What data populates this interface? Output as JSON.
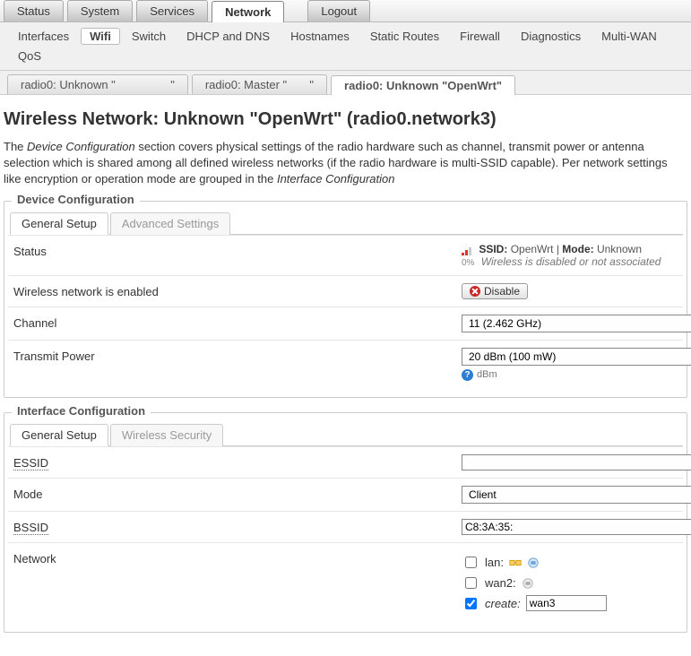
{
  "main_tabs": {
    "status": "Status",
    "system": "System",
    "services": "Services",
    "network": "Network",
    "logout": "Logout"
  },
  "sub_nav": {
    "interfaces": "Interfaces",
    "wifi": "Wifi",
    "switch": "Switch",
    "dhcp_dns": "DHCP and DNS",
    "hostnames": "Hostnames",
    "static_routes": "Static Routes",
    "firewall": "Firewall",
    "diagnostics": "Diagnostics",
    "multi_wan": "Multi-WAN",
    "qos": "QoS"
  },
  "tier3": {
    "t1": "radio0: Unknown \"",
    "t2": "radio0: Master \"",
    "t3": "radio0: Unknown \"OpenWrt\""
  },
  "page": {
    "title": "Wireless Network: Unknown \"OpenWrt\" (radio0.network3)",
    "desc_a": "The ",
    "desc_a_em": "Device Configuration",
    "desc_b": " section covers physical settings of the radio hardware such as channel, transmit power or antenna selection which is shared among all defined wireless networks (if the radio hardware is multi-SSID capable). Per network settings like encryption or operation mode are grouped in the ",
    "desc_b_em": "Interface Configuration"
  },
  "dev": {
    "legend": "Device Configuration",
    "tab_general": "General Setup",
    "tab_adv": "Advanced Settings",
    "status_label": "Status",
    "ssid_lbl": "SSID:",
    "ssid_val": "OpenWrt",
    "mode_lbl": "Mode:",
    "mode_val": "Unknown",
    "pct": "0%",
    "assoc_hint": "Wireless is disabled or not associated",
    "enabled_label": "Wireless network is enabled",
    "disable_btn": "Disable",
    "channel_label": "Channel",
    "channel_val": "11 (2.462 GHz)",
    "tx_label": "Transmit Power",
    "tx_val": "20 dBm (100 mW)",
    "tx_hint": "dBm"
  },
  "iface": {
    "legend": "Interface Configuration",
    "tab_general": "General Setup",
    "tab_sec": "Wireless Security",
    "essid_label": "ESSID",
    "essid_val": " ",
    "mode_label": "Mode",
    "mode_val": "Client",
    "bssid_label": "BSSID",
    "bssid_val": "C8:3A:35:",
    "net_label": "Network",
    "net_lan": "lan:",
    "net_wan2": "wan2:",
    "net_create": "create:",
    "net_create_val": "wan3"
  }
}
